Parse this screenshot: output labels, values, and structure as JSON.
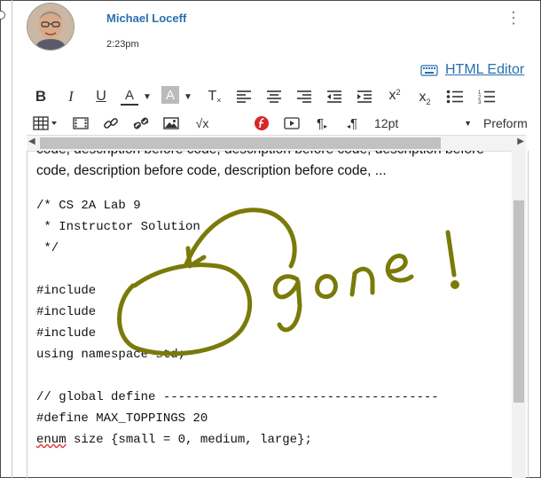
{
  "post": {
    "author": "Michael Loceff",
    "time": "2:23pm"
  },
  "editor_link": {
    "label": "HTML Editor",
    "icon": "keyboard-icon"
  },
  "toolbar_row1": [
    {
      "name": "bold-button",
      "glyph": "B"
    },
    {
      "name": "italic-button",
      "glyph": "I"
    },
    {
      "name": "underline-button",
      "glyph": "U"
    },
    {
      "name": "text-color-button",
      "glyph": "A"
    },
    {
      "name": "text-color-dropdown",
      "glyph": "▾"
    },
    {
      "name": "highlight-color-button",
      "glyph": "A"
    },
    {
      "name": "highlight-color-dropdown",
      "glyph": "▾"
    },
    {
      "name": "clear-formatting-button",
      "glyph": "T"
    },
    {
      "name": "align-left-button",
      "glyph": "≡"
    },
    {
      "name": "align-center-button",
      "glyph": "≡"
    },
    {
      "name": "align-right-button",
      "glyph": "≡"
    },
    {
      "name": "outdent-button",
      "glyph": "⇤"
    },
    {
      "name": "indent-button",
      "glyph": "⇥"
    },
    {
      "name": "superscript-button",
      "glyph": "x²"
    },
    {
      "name": "subscript-button",
      "glyph": "x₂"
    },
    {
      "name": "bullet-list-button",
      "glyph": "•"
    },
    {
      "name": "numbered-list-button",
      "glyph": "1"
    }
  ],
  "toolbar_row2": {
    "font_size": "12pt",
    "format": "Preform"
  },
  "content": {
    "para_line1": "code, description before code, description before code, description before",
    "para_line2": "code, description before code, description before code, ...",
    "code_lines": [
      "/* CS 2A Lab 9",
      " * Instructor Solution",
      " */",
      "",
      "#include",
      "#include",
      "#include",
      "using namespace std;",
      "",
      "// global define -------------------------------------",
      "#define MAX_TOPPINGS 20"
    ],
    "enum_keyword": "enum",
    "enum_rest": " size {small = 0, medium, large};"
  },
  "annotation": {
    "text": "gone!",
    "color": "#7a7a0a"
  }
}
